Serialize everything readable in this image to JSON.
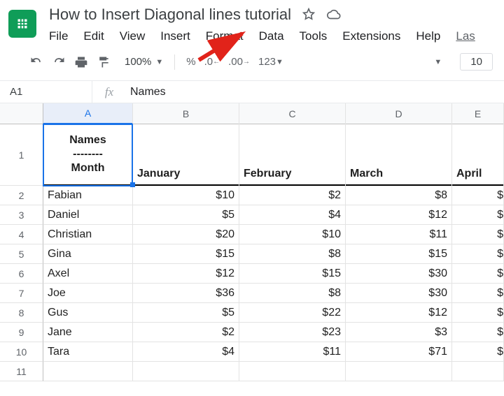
{
  "doc": {
    "title": "How to Insert Diagonal lines tutorial"
  },
  "menubar": {
    "items": [
      "File",
      "Edit",
      "View",
      "Insert",
      "Format",
      "Data",
      "Tools",
      "Extensions",
      "Help"
    ],
    "last_edit_prefix": "Las"
  },
  "toolbar": {
    "zoom": "100%",
    "percent": "%",
    "dec_decrease": ".0",
    "dec_increase": ".00",
    "numfmt": "123",
    "fontsize": "10"
  },
  "formula_bar": {
    "cell_ref": "A1",
    "fx_label": "fx",
    "value": "Names"
  },
  "columns": [
    "A",
    "B",
    "C",
    "D",
    "E"
  ],
  "a1_cell": {
    "line1": "Names",
    "divider": "--------",
    "line2": "Month"
  },
  "header_row": {
    "B": "January",
    "C": "February",
    "D": "March",
    "E": "April"
  },
  "rows": [
    {
      "num": "2",
      "A": "Fabian",
      "B": "$10",
      "C": "$2",
      "D": "$8"
    },
    {
      "num": "3",
      "A": "Daniel",
      "B": "$5",
      "C": "$4",
      "D": "$12"
    },
    {
      "num": "4",
      "A": "Christian",
      "B": "$20",
      "C": "$10",
      "D": "$11"
    },
    {
      "num": "5",
      "A": "Gina",
      "B": "$15",
      "C": "$8",
      "D": "$15"
    },
    {
      "num": "6",
      "A": "Axel",
      "B": "$12",
      "C": "$15",
      "D": "$30"
    },
    {
      "num": "7",
      "A": "Joe",
      "B": "$36",
      "C": "$8",
      "D": "$30"
    },
    {
      "num": "8",
      "A": "Gus",
      "B": "$5",
      "C": "$22",
      "D": "$12"
    },
    {
      "num": "9",
      "A": "Jane",
      "B": "$2",
      "C": "$23",
      "D": "$3"
    },
    {
      "num": "10",
      "A": "Tara",
      "B": "$4",
      "C": "$11",
      "D": "$71"
    },
    {
      "num": "11",
      "A": "",
      "B": "",
      "C": "",
      "D": ""
    }
  ],
  "row1_label": "1",
  "partial_e_value": "$",
  "annotation": {
    "points_to": "menu-format"
  }
}
